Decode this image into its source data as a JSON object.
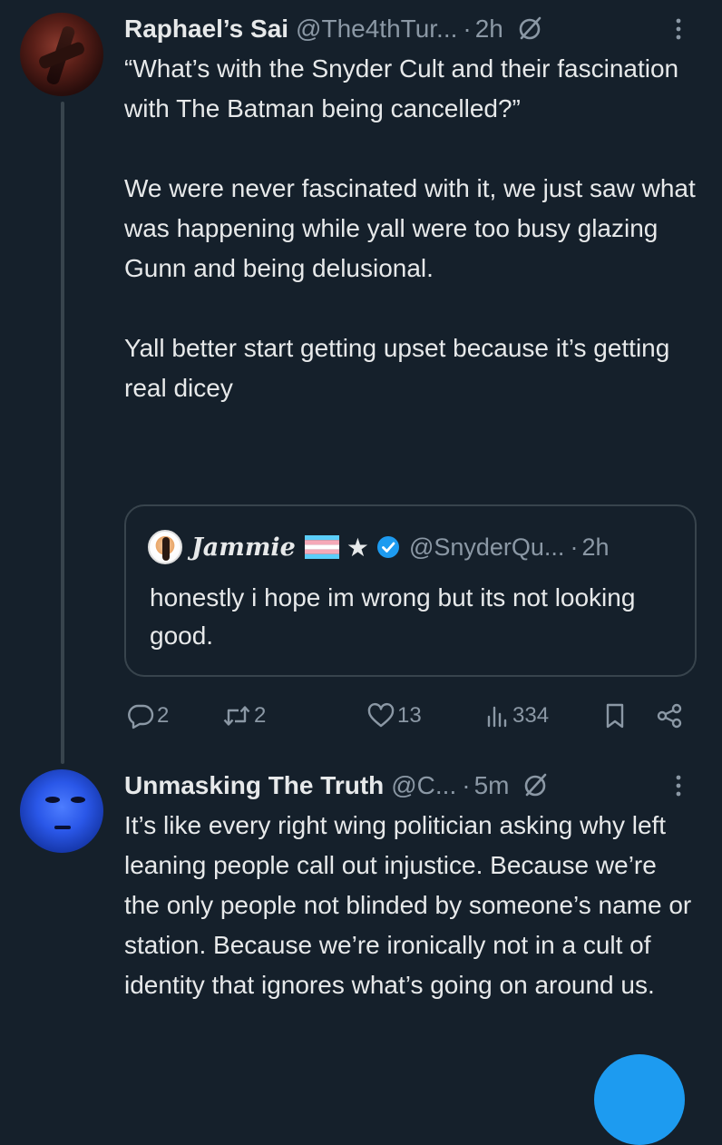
{
  "tweet1": {
    "name": "Raphael’s Sai",
    "handle": "@The4thTur...",
    "separator": "·",
    "time": "2h",
    "paragraphs": [
      "“What’s with the Snyder Cult and their fascination with The Batman being cancelled?”",
      "We were never fascinated with it, we just saw what was happening while yall were too busy glazing Gunn and being delusional.",
      "Yall better start getting upset because it’s getting real dicey"
    ],
    "quote": {
      "name": "Jammie",
      "star": "★",
      "handle": "@SnyderQu...",
      "separator": "·",
      "time": "2h",
      "text": "honestly i hope im wrong but its not looking good."
    },
    "actions": {
      "replies": "2",
      "retweets": "2",
      "likes": "13",
      "views": "334"
    }
  },
  "tweet2": {
    "name": "Unmasking The Truth",
    "handle": "@C...",
    "separator": "·",
    "time": "5m",
    "text": "It’s like every right wing politician asking why left leaning people call out injustice. Because we’re the only people not blinded by someone’s name or station. Because we’re ironically not in a cult of identity that ignores what’s going on around us."
  },
  "icons": {
    "grok": "grok-icon",
    "more": "more-vertical-icon",
    "reply": "reply-icon",
    "retweet": "retweet-icon",
    "like": "heart-icon",
    "views": "views-icon",
    "bookmark": "bookmark-icon",
    "share": "share-icon",
    "verified": "verified-icon",
    "flag": "trans-flag-icon"
  },
  "colors": {
    "background": "#15202b",
    "text": "#e7e9ea",
    "secondary": "#8b98a5",
    "border": "#38444d",
    "accent": "#1d9bf0"
  }
}
